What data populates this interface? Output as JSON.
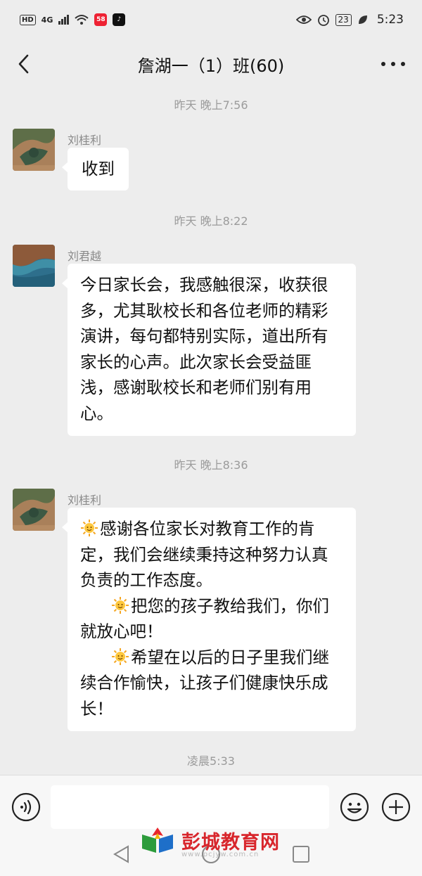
{
  "status_bar": {
    "hd": "HD",
    "network": "4G",
    "app_badge": "58",
    "battery": "23",
    "time": "5:23",
    "icons": [
      "hd-icon",
      "signal-icon",
      "wifi-icon",
      "app58-icon",
      "tiktok-icon",
      "eye-icon",
      "alarm-icon",
      "battery-icon",
      "leaf-icon"
    ]
  },
  "header": {
    "title": "詹湖一（1）班(60)",
    "back_icon": "chevron-left-icon",
    "more_icon": "more-dots-icon"
  },
  "messages": [
    {
      "timestamp": "昨天 晚上7:56",
      "sender": "刘桂利",
      "avatar": "plant-avatar",
      "lines": [
        "收到"
      ]
    },
    {
      "timestamp": "昨天 晚上8:22",
      "sender": "刘君越",
      "avatar": "seascape-avatar",
      "lines": [
        "今日家长会，我感触很深，收获很",
        "多，尤其耿校长和各位老师的精彩",
        "演讲，每句都特别实际，道出所有",
        "家长的心声。此次家长会受益匪",
        "浅，感谢耿校长和老师们别有用",
        "心。"
      ]
    },
    {
      "timestamp": "昨天 晚上8:36",
      "sender": "刘桂利",
      "avatar": "plant-avatar",
      "lines": [
        "感谢各位家长对教育工作的肯",
        "定，我们会继续秉持这种努力认真",
        "负责的工作态度。",
        "把您的孩子教给我们，你们",
        "就放心吧！",
        "希望在以后的日子里我们继",
        "续合作愉快，让孩子们健康快乐成",
        "长！"
      ]
    }
  ],
  "last_timestamp": "凌晨5:33",
  "input_bar": {
    "placeholder": "",
    "voice_icon": "voice-icon",
    "emoji_icon": "emoji-icon",
    "plus_icon": "plus-icon"
  },
  "nav_bar": {
    "icons": [
      "nav-back-icon",
      "nav-home-icon",
      "nav-recent-icon"
    ]
  },
  "watermark": {
    "text": "彭城教育网",
    "sub": "www.pcjyw.com.cn"
  },
  "colors": {
    "background": "#ededed",
    "bubble": "#ffffff",
    "timestamp": "#9b9b9b",
    "watermark": "#d8262c"
  }
}
